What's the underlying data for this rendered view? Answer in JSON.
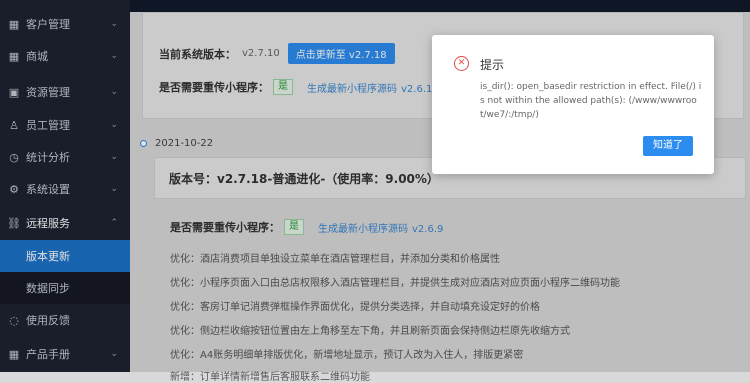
{
  "sidebar": {
    "items": [
      {
        "label": "客户管理",
        "icon": "grid-icon",
        "chev": "⌄"
      },
      {
        "label": "商城",
        "icon": "grid-icon",
        "chev": "⌄"
      },
      {
        "label": "资源管理",
        "icon": "image-icon",
        "chev": "⌄"
      },
      {
        "label": "员工管理",
        "icon": "user-icon",
        "chev": "⌄"
      },
      {
        "label": "统计分析",
        "icon": "clock-icon",
        "chev": "⌄"
      },
      {
        "label": "系统设置",
        "icon": "gear-icon",
        "chev": "⌄"
      },
      {
        "label": "远程服务",
        "icon": "link-icon",
        "chev": "⌃"
      }
    ],
    "sub_items": [
      {
        "label": "版本更新"
      },
      {
        "label": "数据同步"
      }
    ],
    "tail_items": [
      {
        "label": "使用反馈",
        "icon": "chat-icon"
      },
      {
        "label": "产品手册",
        "icon": "grid-icon",
        "chev": "⌄"
      }
    ]
  },
  "current": {
    "version_label": "当前系统版本：",
    "version": "v2.7.10",
    "update_button": "点击更新至 v2.7.18",
    "reupload_label": "是否需要重传小程序：",
    "reupload_tag": "是",
    "source_link": "生成最新小程序源码",
    "source_version": "v2.6.1"
  },
  "release": {
    "date": "2021-10-22",
    "version_line": "版本号：v2.7.18-普通进化-（使用率：9.00%）",
    "reupload_label": "是否需要重传小程序：",
    "reupload_tag": "是",
    "source_link": "生成最新小程序源码",
    "source_version": "v2.6.9",
    "notes": [
      "优化：酒店消费项目单独设立菜单在酒店管理栏目，并添加分类和价格属性",
      "优化：小程序页面入口由总店权限移入酒店管理栏目，并提供生成对应酒店对应页面小程序二维码功能",
      "优化：客房订单记消费弹框操作界面优化，提供分类选择，并自动填充设定好的价格",
      "优化：侧边栏收缩按钮位置由左上角移至左下角，并且刷新页面会保持侧边栏原先收缩方式",
      "优化：A4账务明细单排版优化，新增地址显示，预订人改为入住人，排版更紧密",
      "新增：订单详情新增售后客服联系二维码功能"
    ]
  },
  "modal": {
    "title": "提示",
    "message": "is_dir(): open_basedir restriction in effect. File(/) is not within the allowed path(s): (/www/wwwroot/we7/:/tmp/)",
    "ok_button": "知道了",
    "icon": "error-circle-icon"
  }
}
